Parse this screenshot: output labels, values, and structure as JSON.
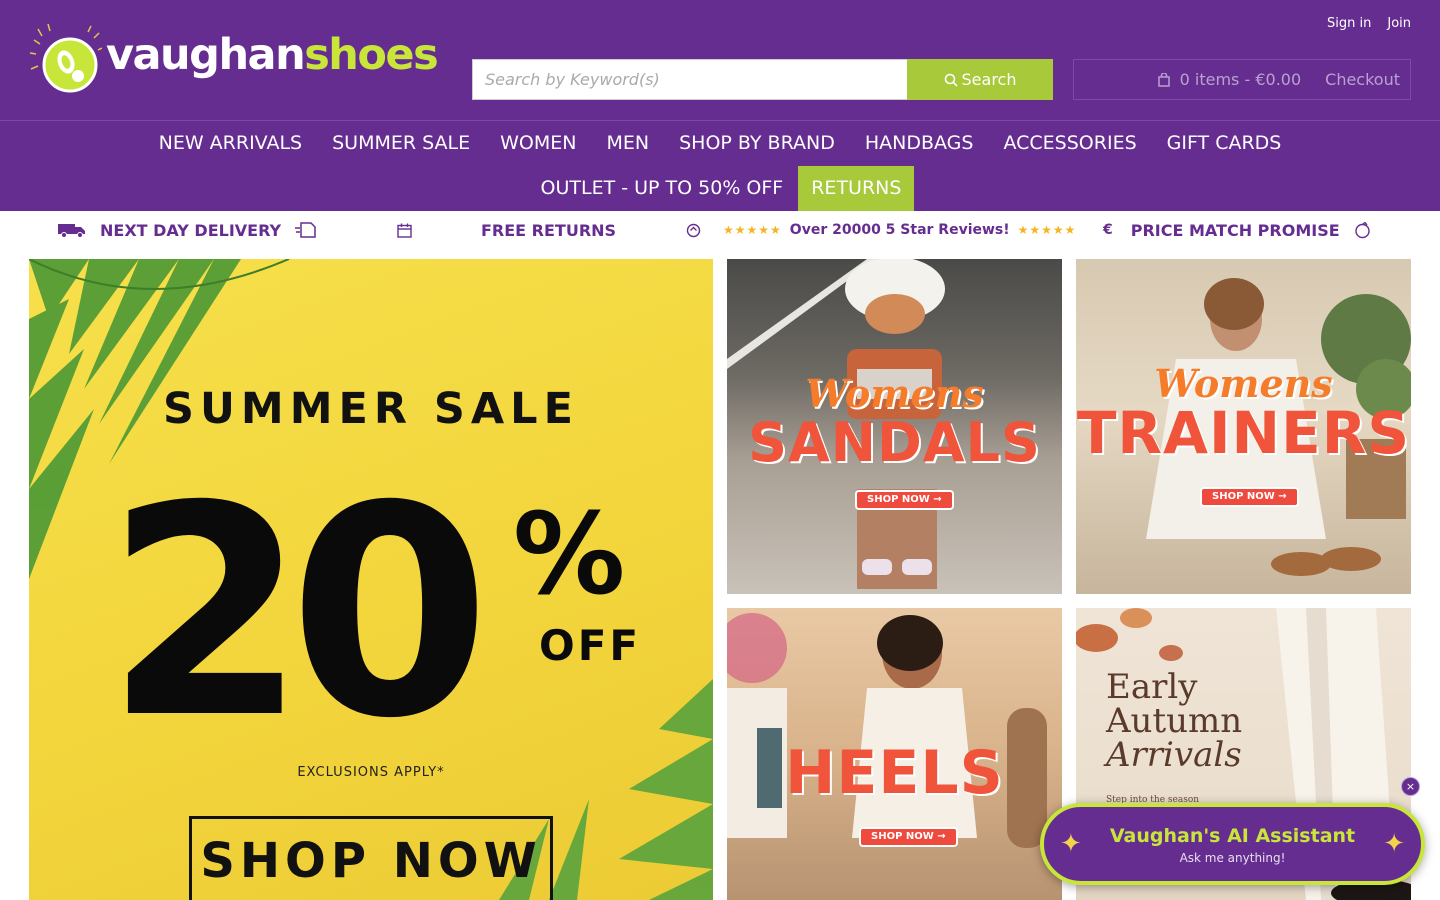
{
  "header": {
    "sign_in": "Sign in",
    "join": "Join",
    "logo_word1": "vaughan",
    "logo_word2": "shoes",
    "search_placeholder": "Search by Keyword(s)",
    "search_button": "Search",
    "cart_items": "0 items - €0.00",
    "checkout": "Checkout"
  },
  "nav": {
    "row1": [
      "NEW ARRIVALS",
      "SUMMER SALE",
      "WOMEN",
      "MEN",
      "SHOP BY BRAND",
      "HANDBAGS",
      "ACCESSORIES",
      "GIFT CARDS"
    ],
    "row2": [
      "OUTLET - UP TO 50% OFF",
      "RETURNS"
    ]
  },
  "usp": {
    "delivery": "NEXT DAY DELIVERY",
    "returns": "FREE RETURNS",
    "reviews": "Over 20000 5 Star Reviews!",
    "price_match": "PRICE MATCH PROMISE",
    "euro_symbol": "€",
    "stars": "★★★★★"
  },
  "hero": {
    "title": "SUMMER SALE",
    "big_number": "20",
    "percent": "%",
    "off": "OFF",
    "exclusions": "EXCLUSIONS APPLY*",
    "button": "SHOP NOW"
  },
  "tiles": {
    "sandals": {
      "line1": "Womens",
      "line2": "SANDALS",
      "button": "SHOP NOW →"
    },
    "trainers": {
      "line1": "Womens",
      "line2": "TRAINERS",
      "button": "SHOP NOW →"
    },
    "heels": {
      "line2": "HEELS",
      "button": "SHOP NOW →"
    },
    "autumn": {
      "line1": "Early",
      "line2": "Autumn",
      "line3": "Arrivals",
      "sub": "Step into the season"
    }
  },
  "ai": {
    "close": "×",
    "title": "Vaughan's AI Assistant",
    "subtitle": "Ask me anything!"
  },
  "colors": {
    "brand_purple": "#662d91",
    "accent_green": "#a8c93a",
    "logo_green": "#c8e63a",
    "hero_yellow": "#f3d53c"
  }
}
